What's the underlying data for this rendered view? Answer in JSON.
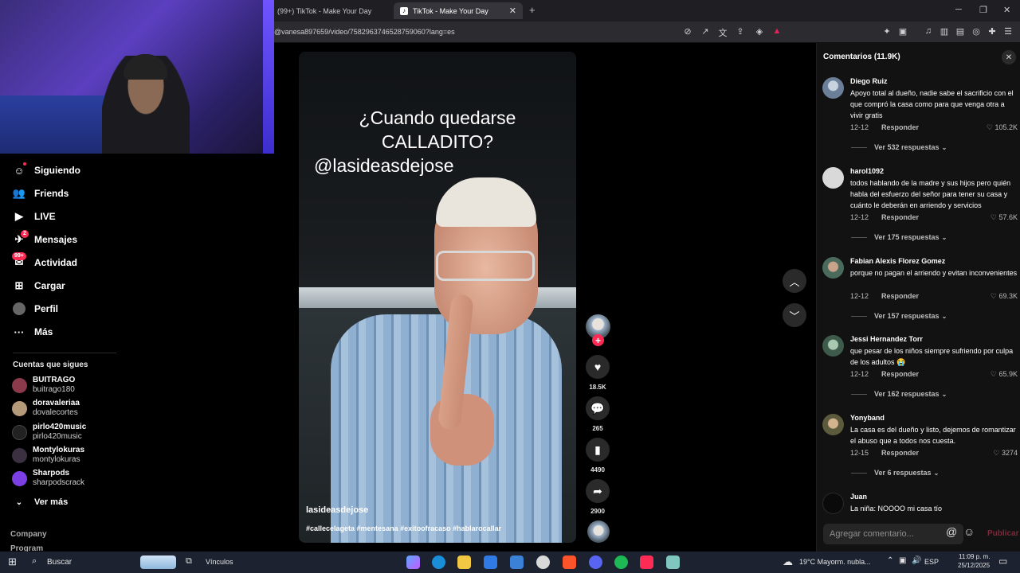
{
  "browser": {
    "tabs": [
      {
        "label": "(99+) TikTok - Make Your Day"
      },
      {
        "label": "TikTok - Make Your Day"
      }
    ],
    "url": "@vanesa897659/video/7582963746528759060?lang=es"
  },
  "sidebar": {
    "items": [
      {
        "label": "Siguiendo",
        "icon": "following-icon"
      },
      {
        "label": "Friends",
        "icon": "friends-icon"
      },
      {
        "label": "LIVE",
        "icon": "live-icon"
      },
      {
        "label": "Mensajes",
        "icon": "messages-icon",
        "badge": "2"
      },
      {
        "label": "Actividad",
        "icon": "activity-icon",
        "badge": "99+"
      },
      {
        "label": "Cargar",
        "icon": "upload-icon"
      },
      {
        "label": "Perfil",
        "icon": "profile-icon"
      },
      {
        "label": "Más",
        "icon": "more-icon"
      }
    ],
    "following_title": "Cuentas que sigues",
    "following": [
      {
        "name": "BUITRAGO",
        "handle": "buitrago180"
      },
      {
        "name": "doravaleriaa",
        "handle": "dovalecortes"
      },
      {
        "name": "pirlo420music",
        "handle": "pirlo420music"
      },
      {
        "name": "Montylokuras",
        "handle": "montylokuras"
      },
      {
        "name": "Sharpods",
        "handle": "sharpodscrack"
      }
    ],
    "see_more": "Ver más",
    "footer": [
      "Company",
      "Program"
    ]
  },
  "video": {
    "title_line1": "¿Cuando quedarse",
    "title_line2": "CALLADITO?",
    "handle_overlay": "@lasideasdejose",
    "author": "lasideasdejose",
    "hashtags": "#callecelageta #mentesana #exitoofracaso #hablarocallar"
  },
  "actions": {
    "likes": "18.5K",
    "comments": "265",
    "saves": "4490",
    "shares": "2900"
  },
  "comments_panel": {
    "title": "Comentarios (11.9K)",
    "reply_label": "Responder",
    "comments": [
      {
        "user": "Diego Ruiz",
        "text": "Apoyo total al dueño, nadie sabe el sacrificio con el que compró la casa como para que venga otra a vivir gratis",
        "date": "12-12",
        "likes": "105.2K",
        "replies": "Ver 532 respuestas"
      },
      {
        "user": "harol1092",
        "text": "todos hablando de la madre y sus hijos pero quién habla del esfuerzo del señor para tener su casa y cuánto le deberán en arriendo y servicios",
        "date": "12-12",
        "likes": "57.6K",
        "replies": "Ver 175 respuestas"
      },
      {
        "user": "Fabian Alexis Florez Gomez",
        "text": "porque no pagan el arriendo y evitan inconvenientes",
        "date": "12-12",
        "likes": "69.3K",
        "replies": "Ver 157 respuestas"
      },
      {
        "user": "Jessi Hernandez Torr",
        "text": "que pesar de los niños siempre sufriendo por culpa de los adultos 😭",
        "date": "12-12",
        "likes": "65.9K",
        "replies": "Ver 162 respuestas"
      },
      {
        "user": "Yonyband",
        "text": "La casa es del dueño y listo, dejemos de romantizar el abuso que a todos nos cuesta.",
        "date": "12-15",
        "likes": "3274",
        "replies": "Ver 6 respuestas"
      },
      {
        "user": "Juan",
        "text": "La niña: NOOOO mi casa tío",
        "date": "",
        "likes": "",
        "replies": ""
      }
    ],
    "input_placeholder": "Agregar comentario...",
    "publish_label": "Publicar"
  },
  "taskbar": {
    "search_label": "Buscar",
    "links_label": "Vínculos",
    "weather": "19°C  Mayorm. nubla...",
    "lang": "ESP",
    "time": "11:09 p. m.",
    "date": "25/12/2025"
  }
}
